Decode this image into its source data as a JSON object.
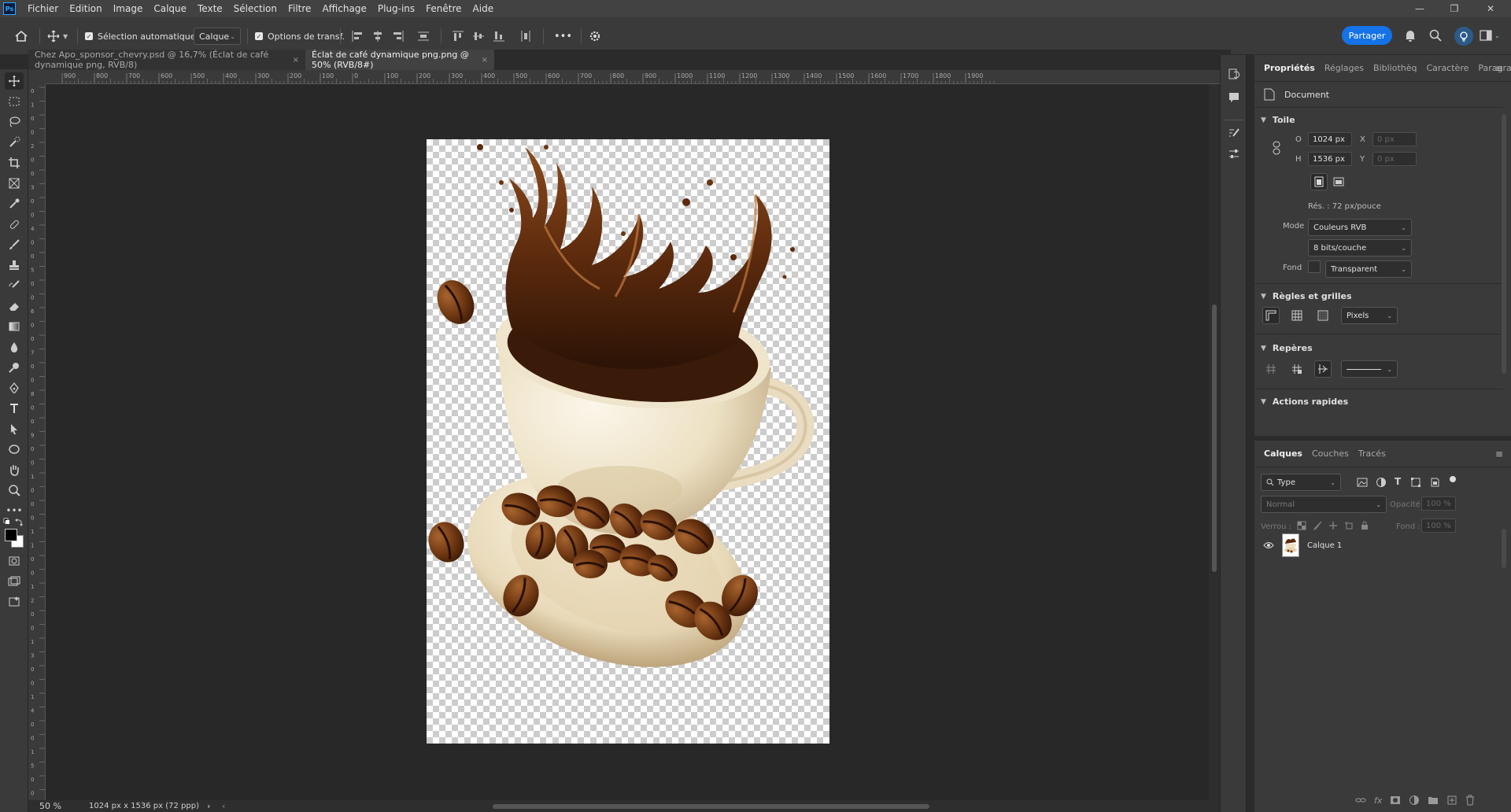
{
  "menubar": {
    "app_icon": "Ps",
    "items": [
      "Fichier",
      "Edition",
      "Image",
      "Calque",
      "Texte",
      "Sélection",
      "Filtre",
      "Affichage",
      "Plug-ins",
      "Fenêtre",
      "Aide"
    ]
  },
  "window_controls": {
    "minimize": "—",
    "restore": "❐",
    "close": "✕"
  },
  "options_bar": {
    "auto_select_label": "Sélection automatique :",
    "auto_select_value": "Calque",
    "transform_label": "Options de transf.",
    "more_label": "•••",
    "share_label": "Partager"
  },
  "tabs": [
    {
      "label": "Chez Apo_sponsor_chevry.psd @ 16,7% (Éclat de café dynamique png, RVB/8)",
      "close": "×"
    },
    {
      "label": "Éclat de café dynamique png.png @ 50% (RVB/8#)",
      "close": "×"
    }
  ],
  "ruler_top_labels": [
    "900",
    "800",
    "700",
    "600",
    "500",
    "400",
    "300",
    "200",
    "100",
    "0",
    "100",
    "200",
    "300",
    "400",
    "500",
    "600",
    "700",
    "800",
    "900",
    "1000",
    "1100",
    "1200",
    "1300",
    "1400",
    "1500",
    "1600",
    "1700",
    "1800",
    "1900"
  ],
  "ruler_left_labels": [
    "0",
    "1",
    "0",
    "0",
    "2",
    "0",
    "0",
    "3",
    "0",
    "0",
    "4",
    "0",
    "0",
    "5",
    "0",
    "0",
    "6",
    "0",
    "0",
    "7",
    "0",
    "0",
    "8",
    "0",
    "0",
    "9",
    "0",
    "0",
    "1",
    "0",
    "0",
    "0",
    "1",
    "1",
    "0",
    "0",
    "1",
    "2",
    "0",
    "0",
    "1",
    "3",
    "0",
    "0",
    "1",
    "4",
    "0",
    "0",
    "1",
    "5",
    "0",
    "0"
  ],
  "statusbar": {
    "zoom": "50 %",
    "doc_info": "1024 px x 1536 px (72 ppp)",
    "arrow": "›",
    "left_arrow": "‹"
  },
  "properties_panel": {
    "tabs": [
      "Propriétés",
      "Réglages",
      "Bibliothèq",
      "Caractère",
      "Paragraph"
    ],
    "document_label": "Document",
    "canvas_section": "Toile",
    "width_label": "O",
    "width_value": "1024 px",
    "height_label": "H",
    "height_value": "1536 px",
    "x_label": "X",
    "x_value": "0 px",
    "y_label": "Y",
    "y_value": "0 px",
    "resolution": "Rés. : 72 px/pouce",
    "mode_label": "Mode",
    "mode_value": "Couleurs RVB",
    "depth_value": "8 bits/couche",
    "fill_label": "Fond",
    "fill_value": "Transparent",
    "rulers_section": "Règles et grilles",
    "units_value": "Pixels",
    "guides_section": "Repères",
    "quick_actions_section": "Actions rapides"
  },
  "layers_panel": {
    "tabs": [
      "Calques",
      "Couches",
      "Tracés"
    ],
    "filter_value": "Type",
    "blend_mode": "Normal",
    "opacity_label": "Opacité :",
    "opacity_value": "100 %",
    "lock_label": "Verrou :",
    "fill_label": "Fond :",
    "fill_value": "100 %",
    "layers": [
      {
        "name": "Calque 1",
        "visible": true
      }
    ]
  },
  "colors": {
    "accent": "#1473e6",
    "panel_bg": "#3a3a3a",
    "workspace_bg": "#282828"
  }
}
